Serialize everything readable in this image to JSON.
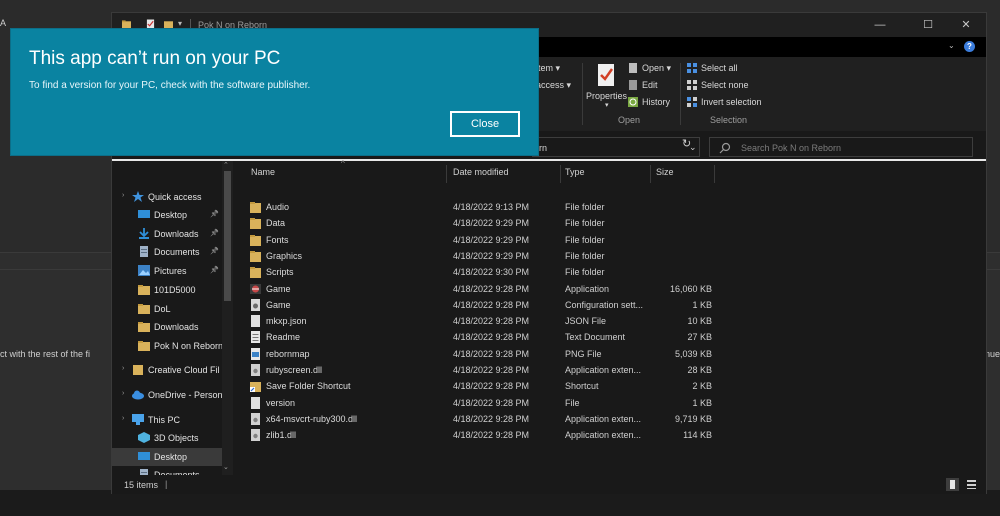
{
  "background": {
    "left_text": "ct with the rest of the fi",
    "right_text": "nue",
    "top_text": "A"
  },
  "explorer": {
    "title": "Pok N on Reborn",
    "ribbon": {
      "item_label": "item",
      "access_label": "access",
      "properties_label": "Properties",
      "open_label": "Open",
      "edit_label": "Edit",
      "history_label": "History",
      "open_group": "Open",
      "select_all": "Select all",
      "select_none": "Select none",
      "invert_selection": "Invert selection",
      "select_group": "Selection"
    },
    "address": "rn",
    "search_placeholder": "Search Pok N on Reborn",
    "nav": {
      "quick_access": "Quick access",
      "items": [
        {
          "label": "Desktop",
          "icon": "desktop-icon",
          "pinned": true
        },
        {
          "label": "Downloads",
          "icon": "downloads-icon",
          "pinned": true
        },
        {
          "label": "Documents",
          "icon": "documents-icon",
          "pinned": true
        },
        {
          "label": "Pictures",
          "icon": "pictures-icon",
          "pinned": true
        },
        {
          "label": "101D5000",
          "icon": "folder-icon",
          "pinned": false
        },
        {
          "label": "DoL",
          "icon": "folder-icon",
          "pinned": false
        },
        {
          "label": "Downloads",
          "icon": "folder-icon",
          "pinned": false
        },
        {
          "label": "Pok N on Reborn",
          "icon": "folder-icon",
          "pinned": false
        }
      ],
      "creative_cloud": "Creative Cloud Fil",
      "onedrive": "OneDrive - Person",
      "this_pc": "This PC",
      "pc_items": [
        {
          "label": "3D Objects",
          "icon": "3d-objects-icon",
          "selected": false
        },
        {
          "label": "Desktop",
          "icon": "desktop-icon",
          "selected": true
        },
        {
          "label": "Documents",
          "icon": "documents-icon",
          "selected": false
        }
      ]
    },
    "columns": {
      "name": "Name",
      "date": "Date modified",
      "type": "Type",
      "size": "Size"
    },
    "files": [
      {
        "name": "Audio",
        "date": "4/18/2022 9:13 PM",
        "type": "File folder",
        "size": "",
        "icon": "folder-icon"
      },
      {
        "name": "Data",
        "date": "4/18/2022 9:29 PM",
        "type": "File folder",
        "size": "",
        "icon": "folder-icon"
      },
      {
        "name": "Fonts",
        "date": "4/18/2022 9:29 PM",
        "type": "File folder",
        "size": "",
        "icon": "folder-icon"
      },
      {
        "name": "Graphics",
        "date": "4/18/2022 9:29 PM",
        "type": "File folder",
        "size": "",
        "icon": "folder-icon"
      },
      {
        "name": "Scripts",
        "date": "4/18/2022 9:30 PM",
        "type": "File folder",
        "size": "",
        "icon": "folder-icon"
      },
      {
        "name": "Game",
        "date": "4/18/2022 9:28 PM",
        "type": "Application",
        "size": "16,060 KB",
        "icon": "app-icon"
      },
      {
        "name": "Game",
        "date": "4/18/2022 9:28 PM",
        "type": "Configuration sett...",
        "size": "1 KB",
        "icon": "config-icon"
      },
      {
        "name": "mkxp.json",
        "date": "4/18/2022 9:28 PM",
        "type": "JSON File",
        "size": "10 KB",
        "icon": "file-icon"
      },
      {
        "name": "Readme",
        "date": "4/18/2022 9:28 PM",
        "type": "Text Document",
        "size": "27 KB",
        "icon": "text-file-icon"
      },
      {
        "name": "rebornmap",
        "date": "4/18/2022 9:28 PM",
        "type": "PNG File",
        "size": "5,039 KB",
        "icon": "image-file-icon"
      },
      {
        "name": "rubyscreen.dll",
        "date": "4/18/2022 9:28 PM",
        "type": "Application exten...",
        "size": "28 KB",
        "icon": "dll-icon"
      },
      {
        "name": "Save Folder Shortcut",
        "date": "4/18/2022 9:28 PM",
        "type": "Shortcut",
        "size": "2 KB",
        "icon": "shortcut-icon"
      },
      {
        "name": "version",
        "date": "4/18/2022 9:28 PM",
        "type": "File",
        "size": "1 KB",
        "icon": "file-icon"
      },
      {
        "name": "x64-msvcrt-ruby300.dll",
        "date": "4/18/2022 9:28 PM",
        "type": "Application exten...",
        "size": "9,719 KB",
        "icon": "dll-icon"
      },
      {
        "name": "zlib1.dll",
        "date": "4/18/2022 9:28 PM",
        "type": "Application exten...",
        "size": "114 KB",
        "icon": "dll-icon"
      }
    ],
    "status": "15 items",
    "status_sep": "|"
  },
  "dialog": {
    "title": "This app can’t run on your PC",
    "message": "To find a version for your PC, check with the software publisher.",
    "close_label": "Close",
    "bg_color": "#0a83a1"
  }
}
